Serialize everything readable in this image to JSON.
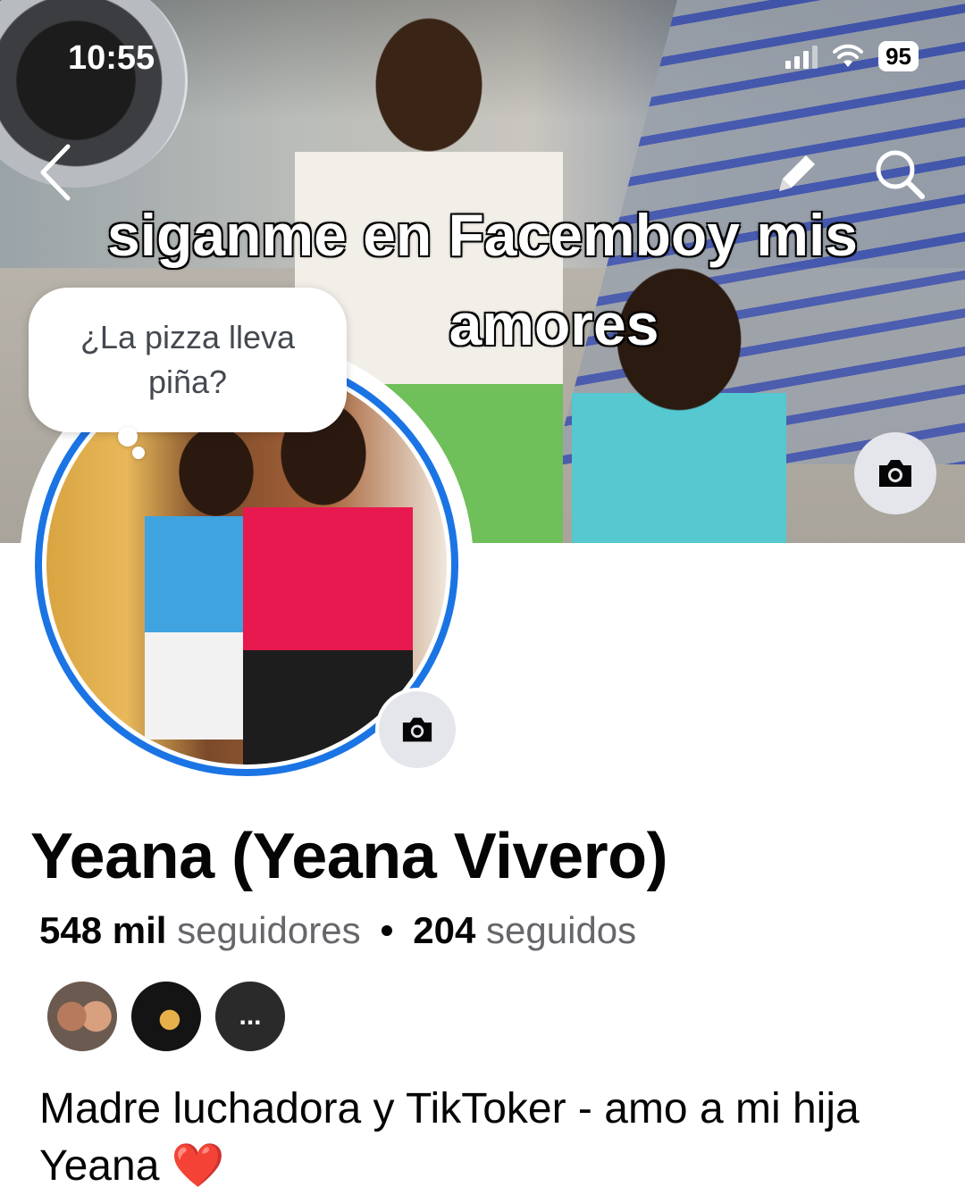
{
  "status_bar": {
    "time": "10:55",
    "battery": "95"
  },
  "cover": {
    "caption_line1": "siganme en Facemboy mis",
    "caption_line2": "amores"
  },
  "profile": {
    "thought_bubble": "¿La pizza lleva piña?",
    "name": "Yeana (Yeana Vivero)",
    "followers_count": "548 mil",
    "followers_label": "seguidores",
    "separator": "•",
    "following_count": "204",
    "following_label": "seguidos",
    "more_friends_label": "...",
    "bio": "Madre luchadora y TikToker - amo a mi hija Yeana",
    "bio_emoji": "❤️"
  },
  "icons": {
    "back": "chevron-left-icon",
    "edit": "pencil-icon",
    "search": "search-icon",
    "camera": "camera-icon"
  },
  "colors": {
    "accent": "#1b74e4",
    "muted_text": "#65676b"
  }
}
